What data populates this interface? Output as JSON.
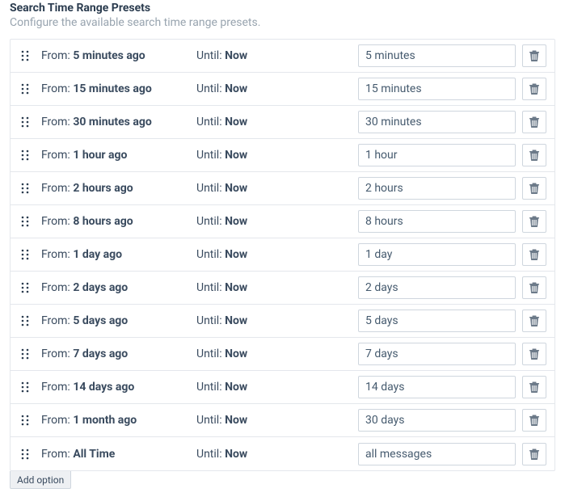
{
  "heading": "Search Time Range Presets",
  "subheading": "Configure the available search time range presets.",
  "from_label": "From:",
  "until_label": "Until:",
  "add_option_label": "Add option",
  "presets": [
    {
      "from": "5 minutes ago",
      "until": "Now",
      "label": "5 minutes"
    },
    {
      "from": "15 minutes ago",
      "until": "Now",
      "label": "15 minutes"
    },
    {
      "from": "30 minutes ago",
      "until": "Now",
      "label": "30 minutes"
    },
    {
      "from": "1 hour ago",
      "until": "Now",
      "label": "1 hour"
    },
    {
      "from": "2 hours ago",
      "until": "Now",
      "label": "2 hours"
    },
    {
      "from": "8 hours ago",
      "until": "Now",
      "label": "8 hours"
    },
    {
      "from": "1 day ago",
      "until": "Now",
      "label": "1 day"
    },
    {
      "from": "2 days ago",
      "until": "Now",
      "label": "2 days"
    },
    {
      "from": "5 days ago",
      "until": "Now",
      "label": "5 days"
    },
    {
      "from": "7 days ago",
      "until": "Now",
      "label": "7 days"
    },
    {
      "from": "14 days ago",
      "until": "Now",
      "label": "14 days"
    },
    {
      "from": "1 month ago",
      "until": "Now",
      "label": "30 days"
    },
    {
      "from": "All Time",
      "until": "Now",
      "label": "all messages"
    }
  ]
}
